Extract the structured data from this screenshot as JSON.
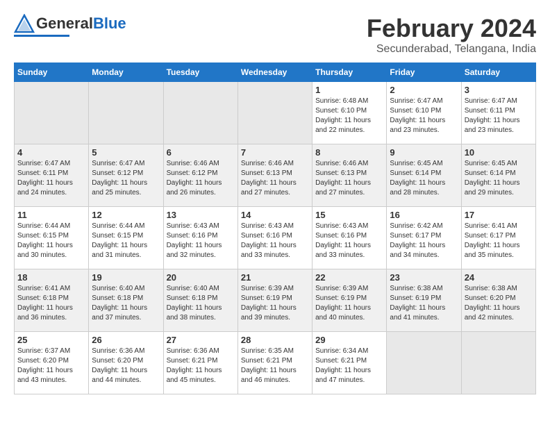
{
  "header": {
    "logo_general": "General",
    "logo_blue": "Blue",
    "month": "February 2024",
    "location": "Secunderabad, Telangana, India"
  },
  "days_of_week": [
    "Sunday",
    "Monday",
    "Tuesday",
    "Wednesday",
    "Thursday",
    "Friday",
    "Saturday"
  ],
  "weeks": [
    [
      {
        "day": "",
        "empty": true
      },
      {
        "day": "",
        "empty": true
      },
      {
        "day": "",
        "empty": true
      },
      {
        "day": "",
        "empty": true
      },
      {
        "day": "1",
        "sunrise": "6:48 AM",
        "sunset": "6:10 PM",
        "daylight": "11 hours and 22 minutes."
      },
      {
        "day": "2",
        "sunrise": "6:47 AM",
        "sunset": "6:10 PM",
        "daylight": "11 hours and 23 minutes."
      },
      {
        "day": "3",
        "sunrise": "6:47 AM",
        "sunset": "6:11 PM",
        "daylight": "11 hours and 23 minutes."
      }
    ],
    [
      {
        "day": "4",
        "sunrise": "6:47 AM",
        "sunset": "6:11 PM",
        "daylight": "11 hours and 24 minutes."
      },
      {
        "day": "5",
        "sunrise": "6:47 AM",
        "sunset": "6:12 PM",
        "daylight": "11 hours and 25 minutes."
      },
      {
        "day": "6",
        "sunrise": "6:46 AM",
        "sunset": "6:12 PM",
        "daylight": "11 hours and 26 minutes."
      },
      {
        "day": "7",
        "sunrise": "6:46 AM",
        "sunset": "6:13 PM",
        "daylight": "11 hours and 27 minutes."
      },
      {
        "day": "8",
        "sunrise": "6:46 AM",
        "sunset": "6:13 PM",
        "daylight": "11 hours and 27 minutes."
      },
      {
        "day": "9",
        "sunrise": "6:45 AM",
        "sunset": "6:14 PM",
        "daylight": "11 hours and 28 minutes."
      },
      {
        "day": "10",
        "sunrise": "6:45 AM",
        "sunset": "6:14 PM",
        "daylight": "11 hours and 29 minutes."
      }
    ],
    [
      {
        "day": "11",
        "sunrise": "6:44 AM",
        "sunset": "6:15 PM",
        "daylight": "11 hours and 30 minutes."
      },
      {
        "day": "12",
        "sunrise": "6:44 AM",
        "sunset": "6:15 PM",
        "daylight": "11 hours and 31 minutes."
      },
      {
        "day": "13",
        "sunrise": "6:43 AM",
        "sunset": "6:16 PM",
        "daylight": "11 hours and 32 minutes."
      },
      {
        "day": "14",
        "sunrise": "6:43 AM",
        "sunset": "6:16 PM",
        "daylight": "11 hours and 33 minutes."
      },
      {
        "day": "15",
        "sunrise": "6:43 AM",
        "sunset": "6:16 PM",
        "daylight": "11 hours and 33 minutes."
      },
      {
        "day": "16",
        "sunrise": "6:42 AM",
        "sunset": "6:17 PM",
        "daylight": "11 hours and 34 minutes."
      },
      {
        "day": "17",
        "sunrise": "6:41 AM",
        "sunset": "6:17 PM",
        "daylight": "11 hours and 35 minutes."
      }
    ],
    [
      {
        "day": "18",
        "sunrise": "6:41 AM",
        "sunset": "6:18 PM",
        "daylight": "11 hours and 36 minutes."
      },
      {
        "day": "19",
        "sunrise": "6:40 AM",
        "sunset": "6:18 PM",
        "daylight": "11 hours and 37 minutes."
      },
      {
        "day": "20",
        "sunrise": "6:40 AM",
        "sunset": "6:18 PM",
        "daylight": "11 hours and 38 minutes."
      },
      {
        "day": "21",
        "sunrise": "6:39 AM",
        "sunset": "6:19 PM",
        "daylight": "11 hours and 39 minutes."
      },
      {
        "day": "22",
        "sunrise": "6:39 AM",
        "sunset": "6:19 PM",
        "daylight": "11 hours and 40 minutes."
      },
      {
        "day": "23",
        "sunrise": "6:38 AM",
        "sunset": "6:19 PM",
        "daylight": "11 hours and 41 minutes."
      },
      {
        "day": "24",
        "sunrise": "6:38 AM",
        "sunset": "6:20 PM",
        "daylight": "11 hours and 42 minutes."
      }
    ],
    [
      {
        "day": "25",
        "sunrise": "6:37 AM",
        "sunset": "6:20 PM",
        "daylight": "11 hours and 43 minutes."
      },
      {
        "day": "26",
        "sunrise": "6:36 AM",
        "sunset": "6:20 PM",
        "daylight": "11 hours and 44 minutes."
      },
      {
        "day": "27",
        "sunrise": "6:36 AM",
        "sunset": "6:21 PM",
        "daylight": "11 hours and 45 minutes."
      },
      {
        "day": "28",
        "sunrise": "6:35 AM",
        "sunset": "6:21 PM",
        "daylight": "11 hours and 46 minutes."
      },
      {
        "day": "29",
        "sunrise": "6:34 AM",
        "sunset": "6:21 PM",
        "daylight": "11 hours and 47 minutes."
      },
      {
        "day": "",
        "empty": true
      },
      {
        "day": "",
        "empty": true
      }
    ]
  ]
}
